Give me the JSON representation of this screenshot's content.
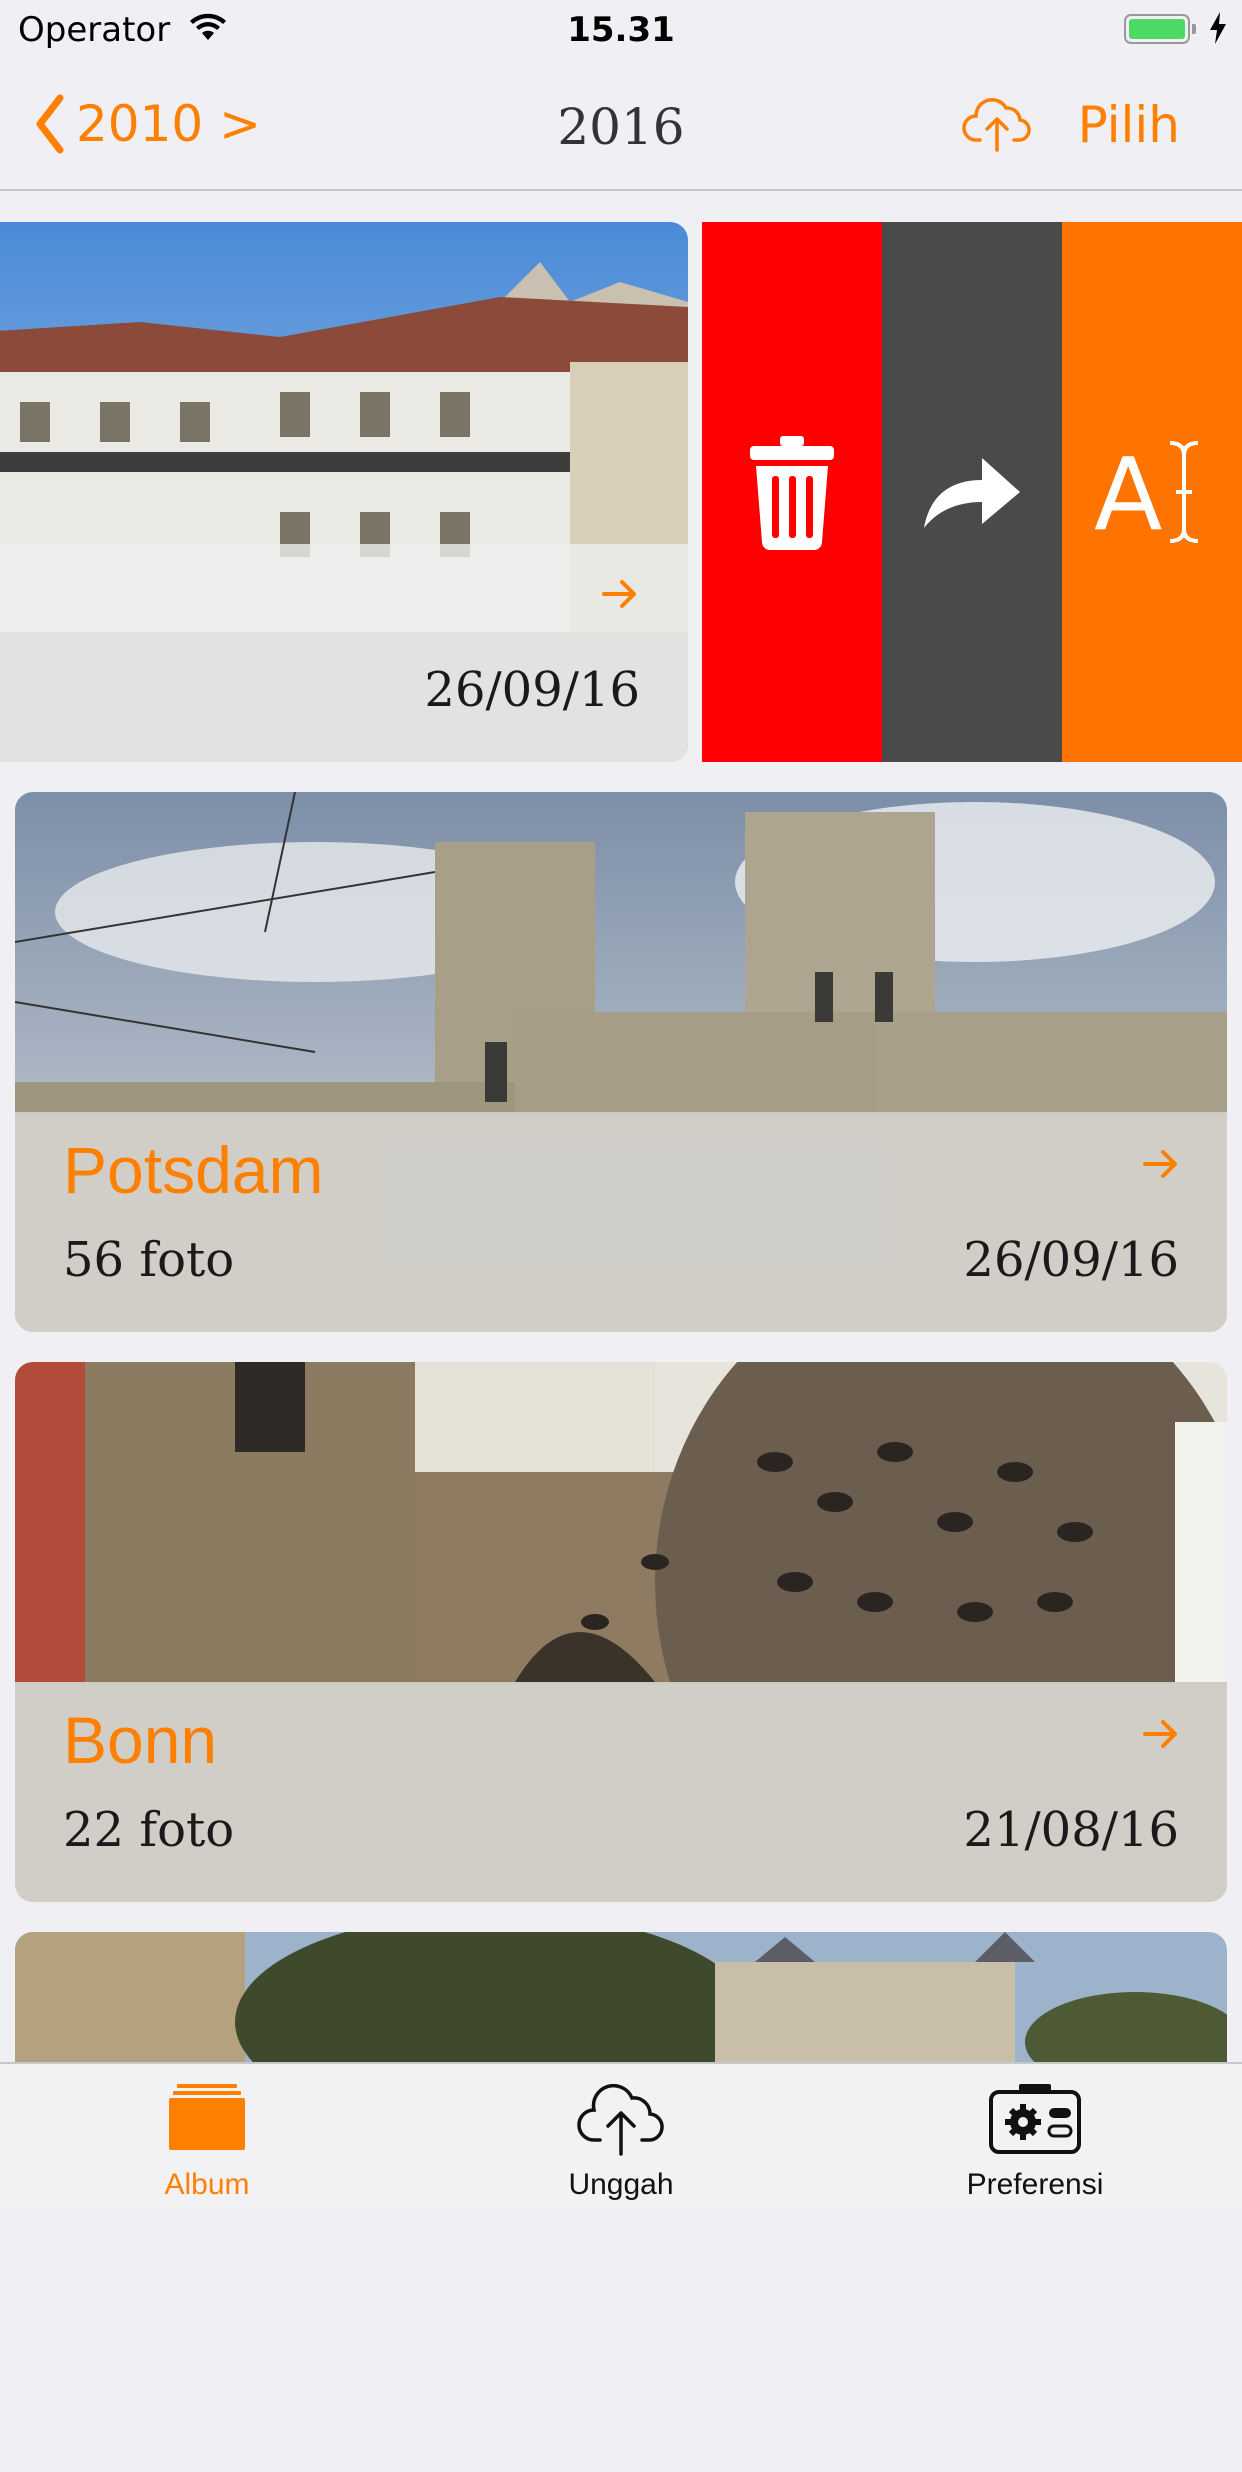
{
  "status": {
    "carrier": "Operator",
    "time": "15.31"
  },
  "nav": {
    "back_label": "2010 >",
    "title": "2016",
    "select_label": "Pilih"
  },
  "albums": [
    {
      "name": "",
      "name_fragment": ")",
      "count": "",
      "date": "26/09/16"
    },
    {
      "name": "Potsdam",
      "count": "56 foto",
      "date": "26/09/16"
    },
    {
      "name": "Bonn",
      "count": "22 foto",
      "date": "21/08/16"
    },
    {
      "name": "",
      "count": "",
      "date": ""
    }
  ],
  "swipe_actions": {
    "delete_icon": "trash-icon",
    "share_icon": "share-arrow-icon",
    "rename_icon": "rename-text-icon",
    "rename_glyph": "A"
  },
  "tabs": [
    {
      "label": "Album",
      "icon": "album-stack-icon",
      "active": true
    },
    {
      "label": "Unggah",
      "icon": "cloud-upload-icon",
      "active": false
    },
    {
      "label": "Preferensi",
      "icon": "preferences-gear-icon",
      "active": false
    }
  ],
  "colors": {
    "accent": "#ff7f00",
    "delete": "#ff0000",
    "share": "#4a4a4a",
    "rename": "#ff7300",
    "background": "#efeff4"
  }
}
